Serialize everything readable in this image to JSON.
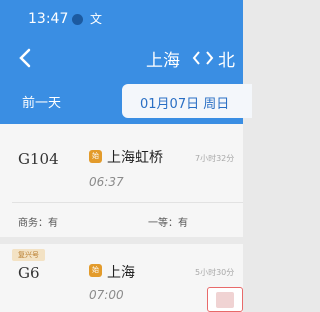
{
  "status_bar": {
    "time": "13:47",
    "glyph": "文"
  },
  "header": {
    "from": "上海",
    "to": "北",
    "prev_day": "前一天",
    "date": "01月07日 周日"
  },
  "trains": [
    {
      "number": "G104",
      "station_badge": "始",
      "station": "上海虹桥",
      "departure": "06:37",
      "duration": "7小时32分",
      "seats": [
        {
          "label": "商务：有"
        },
        {
          "label": "一等：有"
        }
      ]
    },
    {
      "badge": "复兴号",
      "number": "G6",
      "station_badge": "始",
      "station": "上海",
      "departure": "07:00",
      "duration": "5小时30分"
    }
  ],
  "icons": {
    "back": "chevron-left-icon",
    "swap": "swap-arrows-icon",
    "station": "train-station-icon",
    "floating": "filter-icon"
  },
  "colors": {
    "header": "#3a8ee3",
    "accent": "#2a6fc4",
    "station_badge": "#e39b2b"
  }
}
